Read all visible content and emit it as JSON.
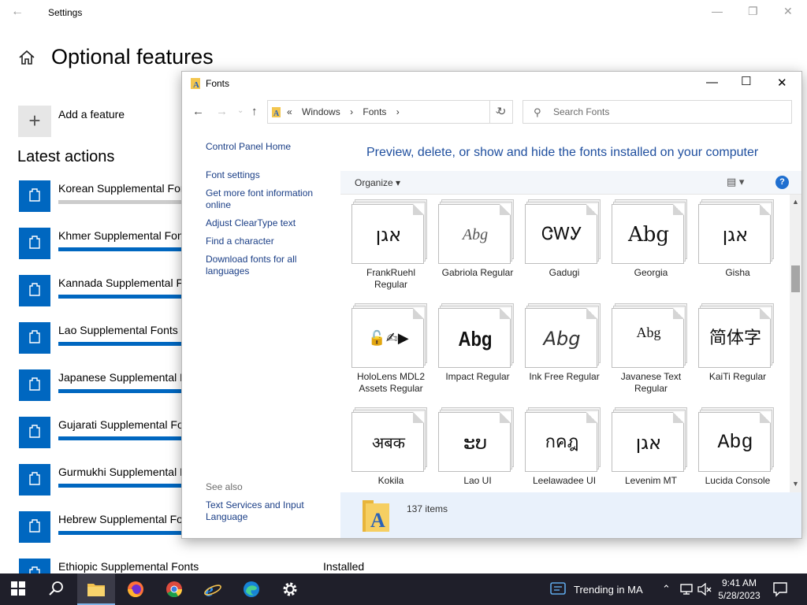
{
  "settings": {
    "window_title": "Settings",
    "page_title": "Optional features",
    "add_feature_label": "Add a feature",
    "section_heading": "Latest actions",
    "features": [
      {
        "name": "Korean Supplemental Fonts",
        "status": "",
        "progress": 0
      },
      {
        "name": "Khmer Supplemental Fonts",
        "status": "",
        "progress": 100
      },
      {
        "name": "Kannada Supplemental Fonts",
        "status": "",
        "progress": 100
      },
      {
        "name": "Lao Supplemental Fonts",
        "status": "",
        "progress": 100
      },
      {
        "name": "Japanese Supplemental Fonts",
        "status": "",
        "progress": 100
      },
      {
        "name": "Gujarati Supplemental Fonts",
        "status": "",
        "progress": 100
      },
      {
        "name": "Gurmukhi Supplemental Fonts",
        "status": "",
        "progress": 100
      },
      {
        "name": "Hebrew Supplemental Fonts",
        "status": "",
        "progress": 100
      },
      {
        "name": "Ethiopic Supplemental Fonts",
        "status": "Installed",
        "progress": 100
      }
    ],
    "accent_color": "#0067c0"
  },
  "fonts_window": {
    "title": "Fonts",
    "address": {
      "prefix": "«",
      "segments": [
        "Windows",
        "Fonts"
      ]
    },
    "search_placeholder": "Search Fonts",
    "left_pane": {
      "links": [
        "Control Panel Home",
        "Font settings",
        "Get more font information online",
        "Adjust ClearType text",
        "Find a character",
        "Download fonts for all languages"
      ],
      "see_also_label": "See also",
      "see_also_links": [
        "Text Services and Input Language"
      ]
    },
    "content_title": "Preview, delete, or show and hide the fonts installed on your computer",
    "organize_label": "Organize",
    "help_label": "?",
    "items_count": "137 items",
    "fonts": [
      {
        "name": "FrankRuehl Regular",
        "sample": "אגן"
      },
      {
        "name": "Gabriola Regular",
        "sample": "Abg"
      },
      {
        "name": "Gadugi",
        "sample": "ᏣᎳᎩ"
      },
      {
        "name": "Georgia",
        "sample": "Abg"
      },
      {
        "name": "Gisha",
        "sample": "אגן"
      },
      {
        "name": "HoloLens MDL2 Assets Regular",
        "sample": "🔓✍▶"
      },
      {
        "name": "Impact Regular",
        "sample": "Abg"
      },
      {
        "name": "Ink Free Regular",
        "sample": "Abg"
      },
      {
        "name": "Javanese Text Regular",
        "sample": "Abg"
      },
      {
        "name": "KaiTi Regular",
        "sample": "简体字"
      },
      {
        "name": "Kokila",
        "sample": "अबक"
      },
      {
        "name": "Lao UI",
        "sample": "ະບ"
      },
      {
        "name": "Leelawadee UI",
        "sample": "กคฎ"
      },
      {
        "name": "Levenim MT",
        "sample": "אגן"
      },
      {
        "name": "Lucida Console",
        "sample": "Abg"
      }
    ]
  },
  "taskbar": {
    "weather_text": "Trending in MA",
    "time": "9:41 AM",
    "date": "5/28/2023"
  }
}
